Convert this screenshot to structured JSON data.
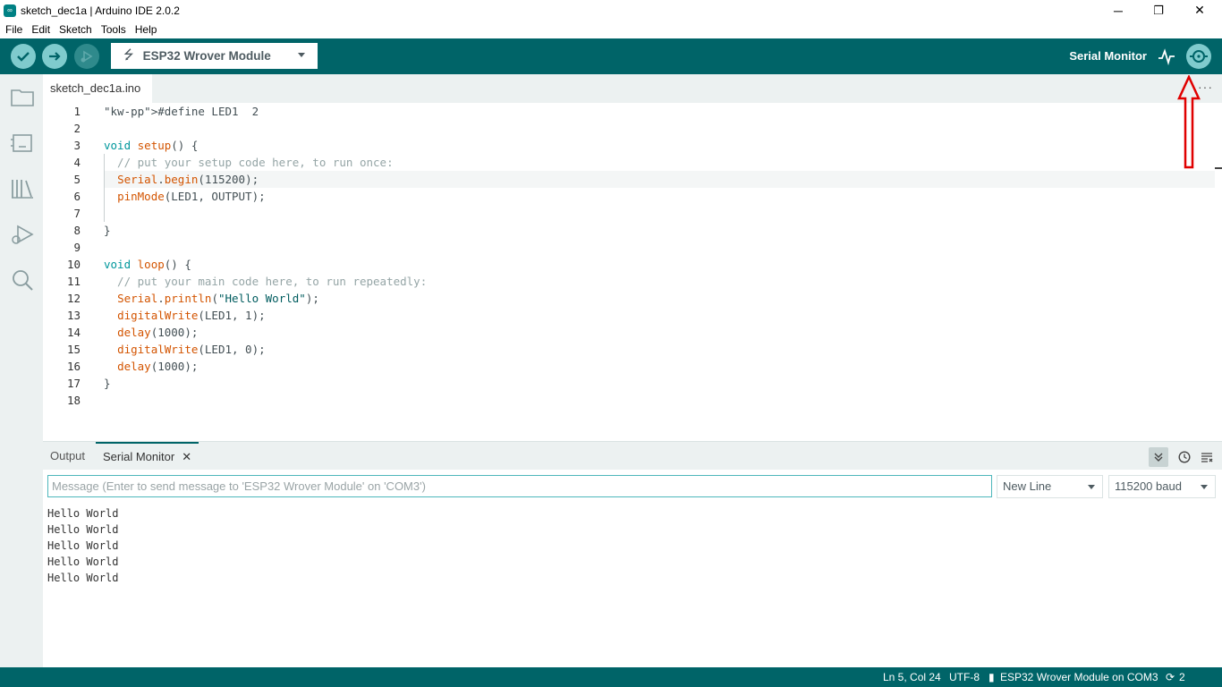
{
  "window": {
    "title": "sketch_dec1a | Arduino IDE 2.0.2",
    "minimize": "─",
    "restore": "❐",
    "close": "✕"
  },
  "menu": [
    "File",
    "Edit",
    "Sketch",
    "Tools",
    "Help"
  ],
  "toolbar": {
    "board": "ESP32 Wrover Module",
    "serial_monitor_label": "Serial Monitor",
    "accent": "#006468"
  },
  "tabs": {
    "file": "sketch_dec1a.ino",
    "more": "···"
  },
  "code": [
    {
      "n": "1",
      "t": "#define LED1  2"
    },
    {
      "n": "2",
      "t": ""
    },
    {
      "n": "3",
      "t": "void setup() {"
    },
    {
      "n": "4",
      "t": "  // put your setup code here, to run once:"
    },
    {
      "n": "5",
      "t": "  Serial.begin(115200);"
    },
    {
      "n": "6",
      "t": "  pinMode(LED1, OUTPUT);"
    },
    {
      "n": "7",
      "t": ""
    },
    {
      "n": "8",
      "t": "}"
    },
    {
      "n": "9",
      "t": ""
    },
    {
      "n": "10",
      "t": "void loop() {"
    },
    {
      "n": "11",
      "t": "  // put your main code here, to run repeatedly:"
    },
    {
      "n": "12",
      "t": "  Serial.println(\"Hello World\");"
    },
    {
      "n": "13",
      "t": "  digitalWrite(LED1, 1);"
    },
    {
      "n": "14",
      "t": "  delay(1000);"
    },
    {
      "n": "15",
      "t": "  digitalWrite(LED1, 0);"
    },
    {
      "n": "16",
      "t": "  delay(1000);"
    },
    {
      "n": "17",
      "t": "}"
    },
    {
      "n": "18",
      "t": ""
    }
  ],
  "panel": {
    "tab_output": "Output",
    "tab_serial": "Serial Monitor",
    "tab_close": "✕",
    "message_placeholder": "Message (Enter to send message to 'ESP32 Wrover Module' on 'COM3')",
    "line_ending": "New Line",
    "baud": "115200 baud",
    "output": [
      "Hello World",
      "Hello World",
      "Hello World",
      "Hello World",
      "Hello World"
    ]
  },
  "status": {
    "position": "Ln 5, Col 24",
    "encoding": "UTF-8",
    "board_port": "ESP32 Wrover Module on COM3",
    "notifications": "2"
  }
}
